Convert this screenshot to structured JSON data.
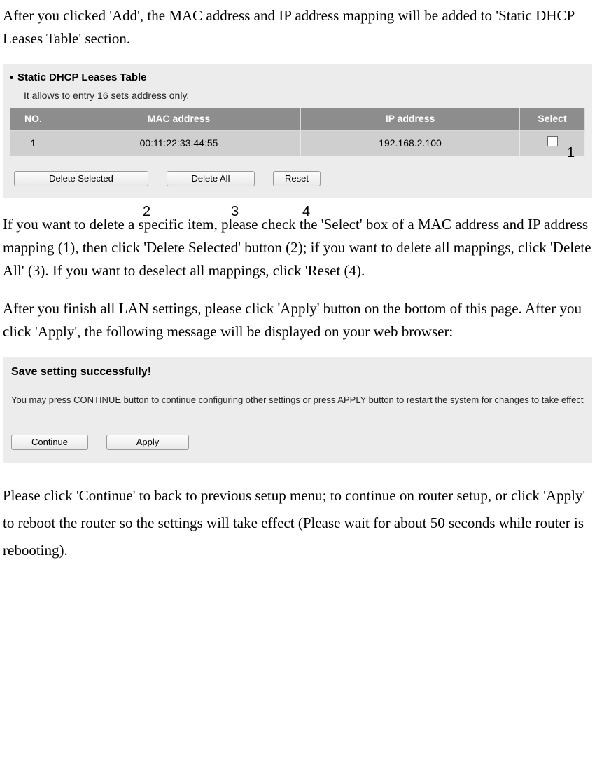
{
  "para1": "After you clicked 'Add', the MAC address and IP address mapping will be added to 'Static DHCP Leases Table' section.",
  "leases_panel": {
    "heading": "Static DHCP Leases Table",
    "subtext": "It allows to entry 16 sets address only.",
    "headers": {
      "no": "NO.",
      "mac": "MAC address",
      "ip": "IP address",
      "select": "Select"
    },
    "row": {
      "no": "1",
      "mac": "00:11:22:33:44:55",
      "ip": "192.168.2.100"
    },
    "buttons": {
      "delete_selected": "Delete Selected",
      "delete_all": "Delete All",
      "reset": "Reset"
    },
    "annot": {
      "a1": "1",
      "a2": "2",
      "a3": "3",
      "a4": "4"
    }
  },
  "para2": "If you want to delete a specific item, please check the 'Select' box of a MAC address and IP address mapping (1), then click 'Delete Selected' button (2); if you want to delete all mappings, click 'Delete All' (3). If you want to deselect all mappings, click 'Reset (4).",
  "para3": "After you finish all LAN settings, please click 'Apply' button on the bottom of this page. After you click 'Apply', the following message will be displayed on your web browser:",
  "save_panel": {
    "title": "Save setting successfully!",
    "msg": "You may press CONTINUE button to continue configuring other settings or press APPLY button to restart the system for changes to take effect",
    "continue": "Continue",
    "apply": "Apply"
  },
  "para4": "Please click 'Continue' to back to previous setup menu; to continue on router setup, or click 'Apply' to reboot the router so the settings will take effect (Please wait for about 50 seconds while router is rebooting)."
}
